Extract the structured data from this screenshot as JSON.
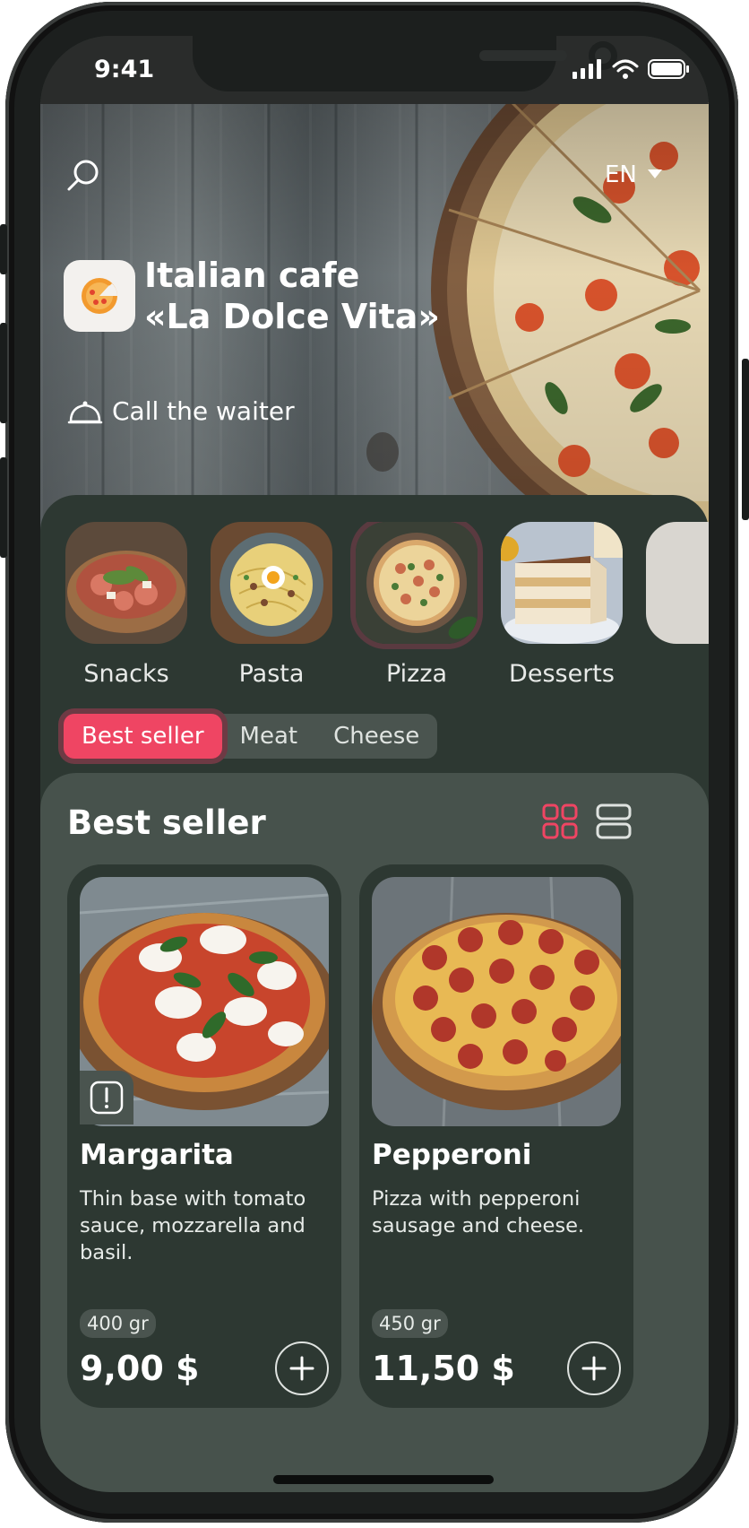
{
  "status_bar": {
    "time": "9:41"
  },
  "header": {
    "language": "EN",
    "cafe_name_line1": "Italian cafe",
    "cafe_name_line2": "«La Dolce Vita»",
    "call_waiter": "Call the waiter"
  },
  "categories": [
    {
      "label": "Snacks",
      "active": false
    },
    {
      "label": "Pasta",
      "active": false
    },
    {
      "label": "Pizza",
      "active": true
    },
    {
      "label": "Desserts",
      "active": false
    }
  ],
  "filters": [
    {
      "label": "Best seller",
      "active": true
    },
    {
      "label": "Meat",
      "active": false
    },
    {
      "label": "Cheese",
      "active": false
    }
  ],
  "section": {
    "title": "Best seller",
    "view_mode": "grid"
  },
  "products": [
    {
      "name": "Margarita",
      "description": "Thin base with tomato sauce, mozzarella and basil.",
      "weight": "400 gr",
      "price": "9,00 $",
      "has_info_badge": true
    },
    {
      "name": "Pepperoni",
      "description": "Pizza with pepperoni sausage and cheese.",
      "weight": "450 gr",
      "price": "11,50 $",
      "has_info_badge": false
    }
  ],
  "colors": {
    "accent": "#ef4563",
    "background": "#2d3832",
    "section_bg": "#47524c",
    "chip_bg": "#4a544f"
  }
}
